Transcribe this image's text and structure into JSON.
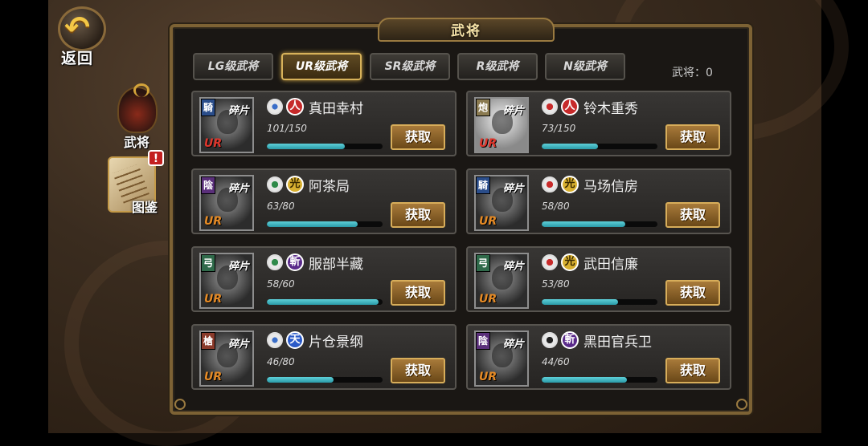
{
  "nav": {
    "back_label": "返回",
    "warrior_label": "武将",
    "collection_label": "图鉴",
    "alert_mark": "!"
  },
  "panel": {
    "title": "武将",
    "count_label": "武将：0"
  },
  "tabs": [
    {
      "label": "LG级武将",
      "active": false
    },
    {
      "label": "UR级武将",
      "active": true
    },
    {
      "label": "SR级武将",
      "active": false
    },
    {
      "label": "R级武将",
      "active": false
    },
    {
      "label": "N级武将",
      "active": false
    }
  ],
  "cards": [
    {
      "class_badge": "騎",
      "shard_label": "碎片",
      "rank": "UR",
      "attr": "人",
      "name": "真田幸村",
      "progress": "101/150",
      "fraction": 0.673,
      "button": "获取"
    },
    {
      "class_badge": "炮",
      "shard_label": "碎片",
      "rank": "UR",
      "attr": "人",
      "name": "铃木重秀",
      "progress": "73/150",
      "fraction": 0.487,
      "button": "获取"
    },
    {
      "class_badge": "陰",
      "shard_label": "碎片",
      "rank": "UR",
      "attr": "光",
      "name": "阿茶局",
      "progress": "63/80",
      "fraction": 0.788,
      "button": "获取"
    },
    {
      "class_badge": "騎",
      "shard_label": "碎片",
      "rank": "UR",
      "attr": "光",
      "name": "马场信房",
      "progress": "58/80",
      "fraction": 0.725,
      "button": "获取"
    },
    {
      "class_badge": "弓",
      "shard_label": "碎片",
      "rank": "UR",
      "attr": "斬",
      "name": "服部半藏",
      "progress": "58/60",
      "fraction": 0.967,
      "button": "获取"
    },
    {
      "class_badge": "弓",
      "shard_label": "碎片",
      "rank": "UR",
      "attr": "光",
      "name": "武田信廉",
      "progress": "53/80",
      "fraction": 0.663,
      "button": "获取"
    },
    {
      "class_badge": "槍",
      "shard_label": "碎片",
      "rank": "UR",
      "attr": "天",
      "name": "片仓景纲",
      "progress": "46/80",
      "fraction": 0.575,
      "button": "获取"
    },
    {
      "class_badge": "陰",
      "shard_label": "碎片",
      "rank": "UR",
      "attr": "斬",
      "name": "黑田官兵卫",
      "progress": "44/60",
      "fraction": 0.733,
      "button": "获取"
    }
  ]
}
